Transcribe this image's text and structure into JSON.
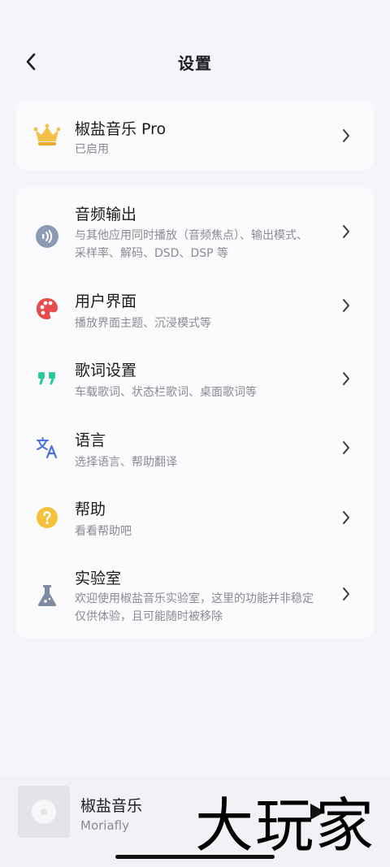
{
  "header": {
    "title": "设置"
  },
  "pro": {
    "title": "椒盐音乐 Pro",
    "status": "已启用"
  },
  "items": [
    {
      "key": "audio",
      "title": "音频输出",
      "subtitle": "与其他应用同时播放（音频焦点）、输出模式、采样率、解码、DSD、DSP 等",
      "icon": "audio-icon",
      "color": "#8c9bb3"
    },
    {
      "key": "ui",
      "title": "用户界面",
      "subtitle": "播放界面主题、沉浸模式等",
      "icon": "palette-icon",
      "color": "#e84b4b"
    },
    {
      "key": "lyrics",
      "title": "歌词设置",
      "subtitle": "车载歌词、状态栏歌词、桌面歌词等",
      "icon": "quote-icon",
      "color": "#2cc9a0"
    },
    {
      "key": "language",
      "title": "语言",
      "subtitle": "选择语言、帮助翻译",
      "icon": "translate-icon",
      "color": "#4a6fe0"
    },
    {
      "key": "help",
      "title": "帮助",
      "subtitle": "看看帮助吧",
      "icon": "help-icon",
      "color": "#f6c03a"
    },
    {
      "key": "lab",
      "title": "实验室",
      "subtitle": "欢迎使用椒盐音乐实验室，这里的功能并非稳定仅供体验，且可能随时被移除",
      "icon": "flask-icon",
      "color": "#7f8aa3"
    }
  ],
  "player": {
    "title": "椒盐音乐",
    "artist": "Moriafly"
  },
  "watermark": {
    "text": "大玩家"
  }
}
